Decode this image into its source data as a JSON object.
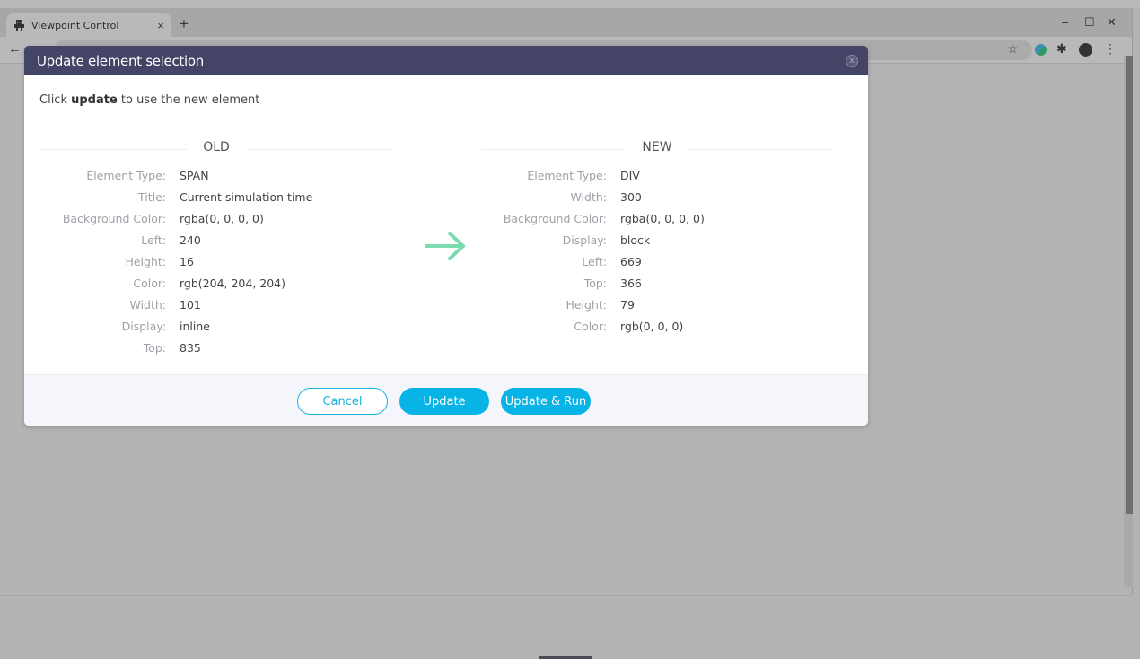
{
  "browser": {
    "tab_title": "Viewpoint Control",
    "tab_close": "×",
    "new_tab": "+",
    "window_controls": {
      "minimize": "–",
      "maximize": "☐",
      "close": "✕"
    },
    "back": "←",
    "bookmark": "☆",
    "extensions": "✱",
    "menu": "⋮"
  },
  "modal": {
    "title": "Update element selection",
    "close_label": "x",
    "instruction": {
      "prefix": "Click ",
      "bold": "update",
      "suffix": " to use the new element"
    },
    "old": {
      "heading": "OLD",
      "rows": [
        {
          "label": "Element Type:",
          "value": "SPAN"
        },
        {
          "label": "Title:",
          "value": "Current simulation time"
        },
        {
          "label": "Background Color:",
          "value": "rgba(0, 0, 0, 0)"
        },
        {
          "label": "Left:",
          "value": "240"
        },
        {
          "label": "Height:",
          "value": "16"
        },
        {
          "label": "Color:",
          "value": "rgb(204, 204, 204)"
        },
        {
          "label": "Width:",
          "value": "101"
        },
        {
          "label": "Display:",
          "value": "inline"
        },
        {
          "label": "Top:",
          "value": "835"
        }
      ]
    },
    "new": {
      "heading": "NEW",
      "rows": [
        {
          "label": "Element Type:",
          "value": "DIV"
        },
        {
          "label": "Width:",
          "value": "300"
        },
        {
          "label": "Background Color:",
          "value": "rgba(0, 0, 0, 0)"
        },
        {
          "label": "Display:",
          "value": "block"
        },
        {
          "label": "Left:",
          "value": "669"
        },
        {
          "label": "Top:",
          "value": "366"
        },
        {
          "label": "Height:",
          "value": "79"
        },
        {
          "label": "Color:",
          "value": "rgb(0, 0, 0)"
        }
      ]
    },
    "buttons": {
      "cancel": "Cancel",
      "update": "Update",
      "update_run": "Update & Run"
    },
    "colors": {
      "header": "#444466",
      "accent": "#08b3e6",
      "arrow": "#7ddbb0"
    }
  }
}
